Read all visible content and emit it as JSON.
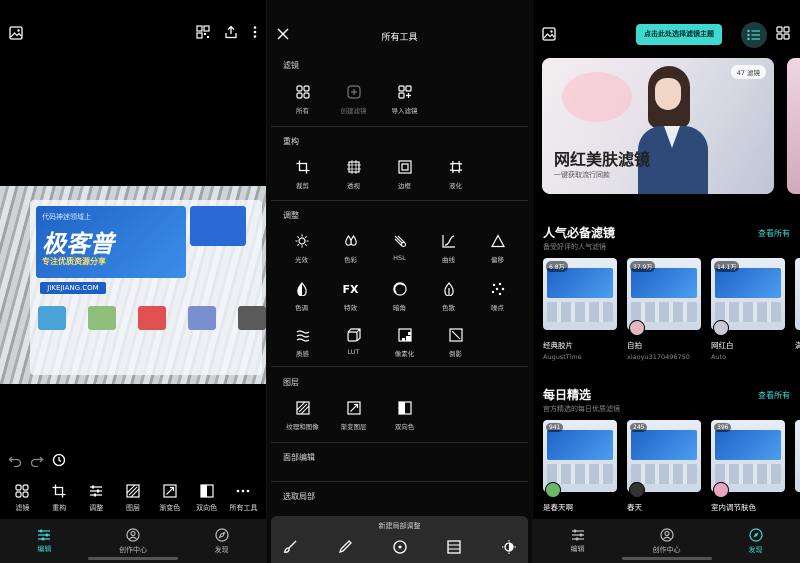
{
  "panel1": {
    "photo_banner": {
      "line1": "代码神迷领域上",
      "title": "极客普",
      "slogan": "专注优质资源分享",
      "url": "JIKEJIANG.COM"
    },
    "tools": [
      {
        "label": "滤镜",
        "icon": "filter-grid-icon"
      },
      {
        "label": "重构",
        "icon": "crop-icon"
      },
      {
        "label": "调整",
        "icon": "sliders-icon"
      },
      {
        "label": "图层",
        "icon": "layers-icon"
      },
      {
        "label": "渐变色",
        "icon": "gradient-icon"
      },
      {
        "label": "双向色",
        "icon": "duotone-icon"
      },
      {
        "label": "所有工具",
        "icon": "more-icon"
      }
    ],
    "nav": [
      {
        "label": "编辑",
        "active": true
      },
      {
        "label": "创作中心",
        "active": false
      },
      {
        "label": "发现",
        "active": false
      }
    ]
  },
  "panel2": {
    "title": "所有工具",
    "sections": [
      {
        "title": "滤镜",
        "items": [
          {
            "label": "所有",
            "icon": "filter-grid-icon"
          },
          {
            "label": "创建滤镜",
            "icon": "add-filter-icon",
            "dim": true
          },
          {
            "label": "导入滤镜",
            "icon": "import-filter-icon"
          }
        ]
      },
      {
        "title": "重构",
        "items": [
          {
            "label": "裁剪",
            "icon": "crop-icon"
          },
          {
            "label": "透视",
            "icon": "perspective-icon"
          },
          {
            "label": "边框",
            "icon": "border-icon"
          },
          {
            "label": "液化",
            "icon": "liquify-icon"
          }
        ]
      },
      {
        "title": "调整",
        "items": [
          {
            "label": "光效",
            "icon": "sun-icon"
          },
          {
            "label": "色彩",
            "icon": "drops-icon"
          },
          {
            "label": "HSL",
            "icon": "hsl-icon"
          },
          {
            "label": "曲线",
            "icon": "curve-icon"
          },
          {
            "label": "偏移",
            "icon": "triangle-icon"
          },
          {
            "label": "色调",
            "icon": "tone-drop-icon"
          },
          {
            "label": "特效",
            "icon": "fx-icon"
          },
          {
            "label": "暗角",
            "icon": "vignette-icon"
          },
          {
            "label": "色散",
            "icon": "dispersion-icon"
          },
          {
            "label": "噪点",
            "icon": "noise-icon"
          },
          {
            "label": "质感",
            "icon": "texture-wave-icon"
          },
          {
            "label": "LUT",
            "icon": "lut-cube-icon"
          },
          {
            "label": "像素化",
            "icon": "pixelate-icon"
          },
          {
            "label": "倒影",
            "icon": "reflection-icon"
          }
        ]
      },
      {
        "title": "图层",
        "items": [
          {
            "label": "纹理和图像",
            "icon": "texture-image-icon"
          },
          {
            "label": "渐变图层",
            "icon": "gradient-layer-icon"
          },
          {
            "label": "双向色",
            "icon": "duotone-icon"
          }
        ]
      }
    ],
    "rows": [
      "面部编辑",
      "选取局部"
    ],
    "bottom_sheet_label": "新建局部调整",
    "bottom_icons": [
      "brush-icon",
      "dropper-icon",
      "radial-icon",
      "linear-icon",
      "light-icon"
    ]
  },
  "panel3": {
    "theme_button": "点击此处选择滤镜主题",
    "hero": {
      "badge": "47 滤镜",
      "title": "网红美肤滤镜",
      "subtitle": "一键获取流行同款"
    },
    "popular": {
      "title": "人气必备滤镜",
      "subtitle": "备受好评的人气滤镜",
      "more": "查看所有",
      "cards": [
        {
          "count": "6.8万",
          "name": "经典胶片",
          "author": "AugustTime",
          "avatar": "#6e7aa0"
        },
        {
          "count": "37.9万",
          "name": "自拍",
          "author": "xiaoyu3170496750",
          "avatar": "#e3b6c0"
        },
        {
          "count": "14.1万",
          "name": "网红白",
          "author": "Auto",
          "avatar": "#c9c9d6"
        },
        {
          "count": "",
          "name": "满",
          "author": "",
          "avatar": "#888888"
        }
      ]
    },
    "daily": {
      "title": "每日精选",
      "subtitle": "官方精选的每日优质滤镜",
      "more": "查看所有",
      "cards": [
        {
          "count": "941",
          "name": "是春天啊",
          "author": "",
          "avatar": "#6bb86b"
        },
        {
          "count": "245",
          "name": "春天",
          "author": "",
          "avatar": "#333333"
        },
        {
          "count": "396",
          "name": "室内调节肤色",
          "author": "",
          "avatar": "#e8a5c0"
        },
        {
          "count": "",
          "name": "",
          "author": "",
          "avatar": "#888888"
        }
      ]
    },
    "nav": [
      {
        "label": "编辑",
        "active": false
      },
      {
        "label": "创作中心",
        "active": false
      },
      {
        "label": "发现",
        "active": true
      }
    ]
  }
}
